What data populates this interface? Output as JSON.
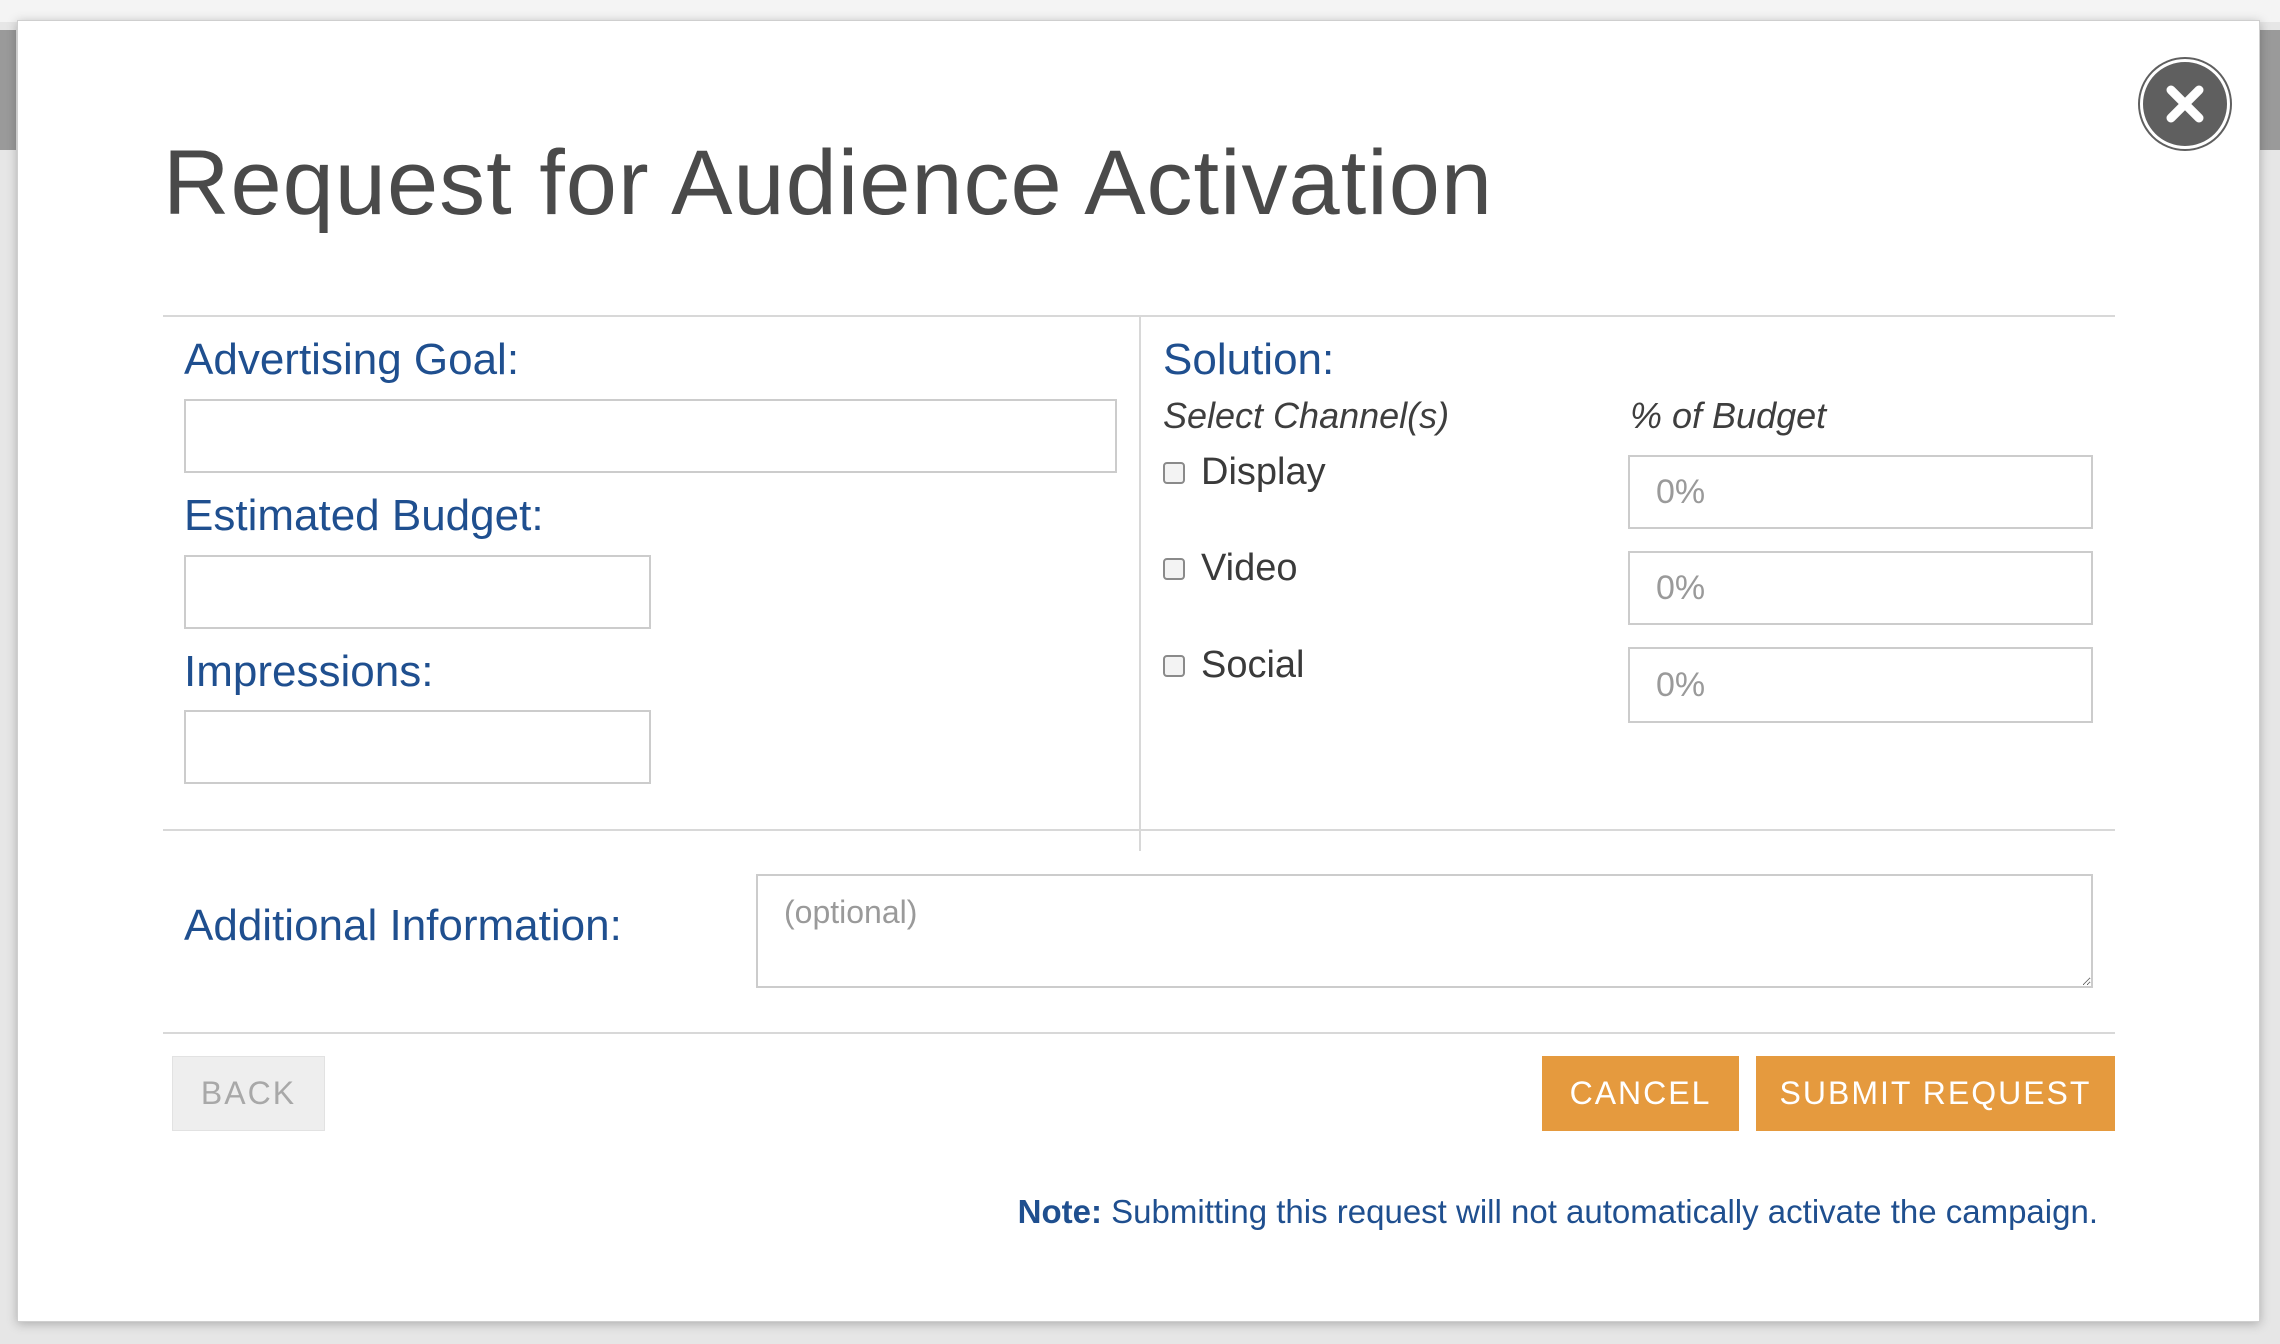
{
  "modal": {
    "title": "Request for Audience Activation",
    "close_icon": "close-icon"
  },
  "form": {
    "advertising_goal": {
      "label": "Advertising Goal:",
      "value": ""
    },
    "estimated_budget": {
      "label": "Estimated Budget:",
      "value": ""
    },
    "impressions": {
      "label": "Impressions:",
      "value": ""
    },
    "solution": {
      "label": "Solution:",
      "channels_header": "Select Channel(s)",
      "budget_header": "% of Budget",
      "channels": [
        {
          "label": "Display",
          "checked": false,
          "budget_placeholder": "0%"
        },
        {
          "label": "Video",
          "checked": false,
          "budget_placeholder": "0%"
        },
        {
          "label": "Social",
          "checked": false,
          "budget_placeholder": "0%"
        }
      ]
    },
    "additional_info": {
      "label": "Additional Information:",
      "placeholder": "(optional)"
    }
  },
  "footer": {
    "back_label": "BACK",
    "cancel_label": "CANCEL",
    "submit_label": "SUBMIT REQUEST",
    "note_prefix": "Note:",
    "note_text": " Submitting this request will not automatically activate the campaign."
  },
  "colors": {
    "label_blue": "#1f4f8f",
    "button_orange": "#e59a3e",
    "close_gray": "#5f5f5f"
  }
}
